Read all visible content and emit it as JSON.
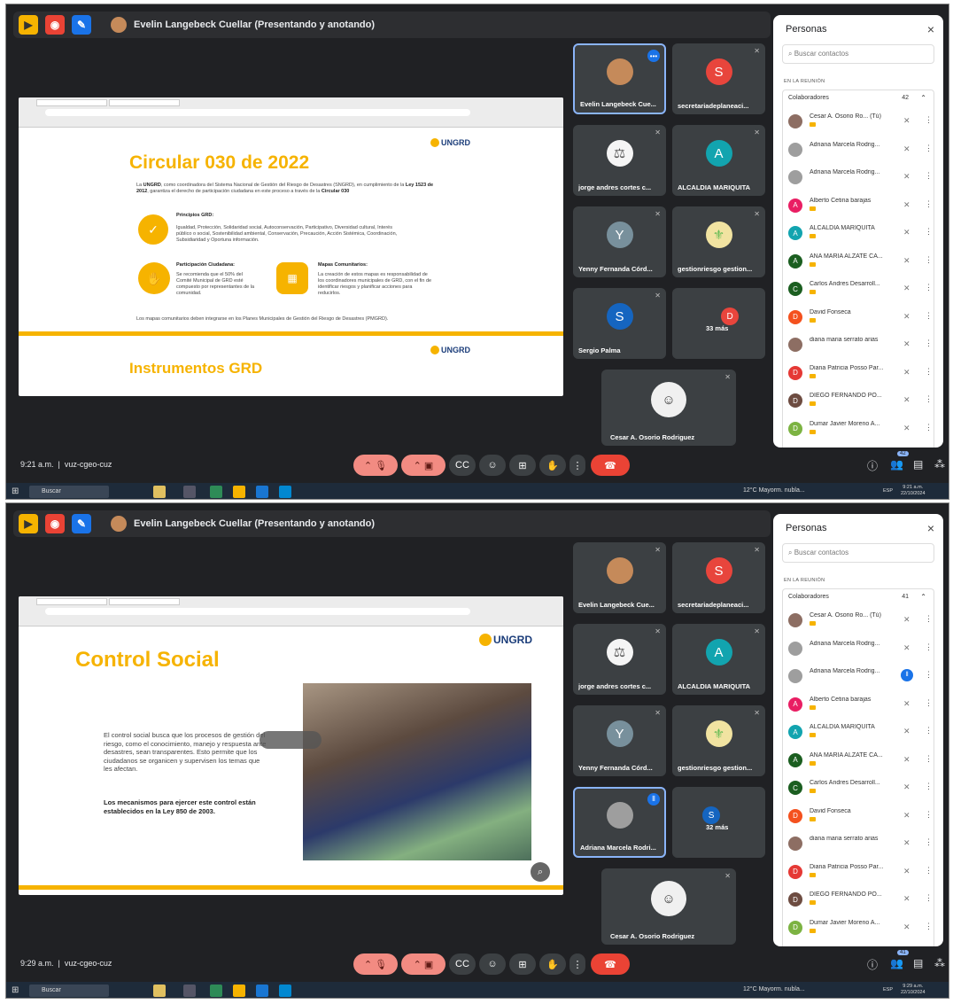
{
  "presenter_title": "Evelin Langebeck Cuellar (Presentando y anotando)",
  "screenshots": [
    {
      "slide": {
        "heading": "Circular 030 de 2022",
        "intro_prefix": "La ",
        "intro_bold1": "UNGRD",
        "intro_mid": ", como coordinadora del Sistema Nacional de Gestión del Riesgo de Desastres (SNGRD), en cumplimiento de la ",
        "intro_bold2": "Ley 1523 de 2012",
        "intro_mid2": ", garantiza el derecho de participación ciudadana en este proceso a través de la ",
        "intro_bold3": "Circular 030",
        "principios_title": "Principios GRD:",
        "principios_text": "Igualdad, Protección, Solidaridad social, Autoconservación, Participativo, Diversidad cultural, Interés público o social, Sostenibilidad ambiental, Conservación, Precaución, Acción Sistémica, Coordinación, Subsidiaridad y Oportuna información.",
        "participacion_title": "Participación Ciudadana:",
        "participacion_text": "Se recomienda que el 50% del Comité Municipal de GRD esté compuesto por representantes de la comunidad.",
        "mapas_title": "Mapas Comunitarios:",
        "mapas_text": "La creación de estos mapas es responsabilidad de los coordinadores municipales de GRD, con el fin de identificar riesgos y planificar acciones para reducirlos.",
        "footer_text": "Los mapas comunitarios deben integrarse en los Planes Municipales de Gestión del Riesgo de Desastres (PMGRD).",
        "heading2": "Instrumentos GRD",
        "logo": "UNGRD"
      },
      "tiles": [
        {
          "name": "Evelin Langebeck Cue...",
          "type": "photo"
        },
        {
          "name": "secretariadeplaneaci...",
          "letter": "S",
          "color": "#e8453c"
        },
        {
          "name": "jorge andres cortes c...",
          "type": "photo"
        },
        {
          "name": "ALCALDIA MARIQUITA",
          "letter": "A",
          "color": "#12a4af"
        },
        {
          "name": "Yenny Fernanda Córd...",
          "letter": "Y",
          "color": "#78909c"
        },
        {
          "name": "gestionriesgo gestion...",
          "type": "crest"
        },
        {
          "name": "Sergio Palma",
          "letter": "S",
          "color": "#1565c0"
        },
        {
          "name": "33 más",
          "letter": "D",
          "color": "#e8453c"
        },
        {
          "name": "Cesar A. Osorio Rodriguez",
          "type": "photo"
        }
      ],
      "time": "9:21 a.m.",
      "meeting_code": "vuz-cgeo-cuz",
      "people_count": "42",
      "clock_time": "9:21 a.m.",
      "clock_date": "22/10/2024"
    },
    {
      "slide": {
        "heading": "Control Social",
        "body": "El control social busca que los procesos de gestión del riesgo, como el conocimiento, manejo y respuesta ante desastres, sean transparentes. Esto permite que los ciudadanos se organicen y supervisen los temas que les afectan.",
        "bold": "Los mecanismos para ejercer este control están establecidos en la Ley 850 de 2003.",
        "logo": "UNGRD"
      },
      "tiles": [
        {
          "name": "Evelin Langebeck Cue...",
          "type": "photo"
        },
        {
          "name": "secretariadeplaneaci...",
          "letter": "S",
          "color": "#e8453c"
        },
        {
          "name": "jorge andres cortes c...",
          "type": "photo"
        },
        {
          "name": "ALCALDIA MARIQUITA",
          "letter": "A",
          "color": "#12a4af"
        },
        {
          "name": "Yenny Fernanda Córd...",
          "letter": "Y",
          "color": "#78909c"
        },
        {
          "name": "gestionriesgo gestion...",
          "type": "crest"
        },
        {
          "name": "Adriana Marcela Rodri...",
          "type": "photo"
        },
        {
          "name": "32 más",
          "letter": "S",
          "color": "#1565c0"
        },
        {
          "name": "Cesar A. Osorio Rodriguez",
          "type": "photo"
        }
      ],
      "time": "9:29 a.m.",
      "meeting_code": "vuz-cgeo-cuz",
      "people_count": "41",
      "clock_time": "9:29 a.m.",
      "clock_date": "22/10/2024"
    }
  ],
  "panel": {
    "title": "Personas",
    "search_placeholder": "Buscar contactos",
    "section": "EN LA REUNIÓN",
    "group": "Colaboradores",
    "counts": [
      "42",
      "41"
    ],
    "people": [
      {
        "name": "Cesar A. Osorio Ro... (Tú)",
        "letter": "",
        "color": "#8d6e63"
      },
      {
        "name": "Adriana Marcela Rodrig...",
        "letter": "",
        "color": "#9e9e9e"
      },
      {
        "name": "Adriana Marcela Rodrig...",
        "letter": "",
        "color": "#9e9e9e"
      },
      {
        "name": "Alberto Cetina barajas",
        "letter": "A",
        "color": "#e91e63"
      },
      {
        "name": "ALCALDIA MARIQUITA",
        "letter": "A",
        "color": "#12a4af"
      },
      {
        "name": "ANA MARIA ALZATE CA...",
        "letter": "A",
        "color": "#1b5e20"
      },
      {
        "name": "Carlos Andres Desarroll...",
        "letter": "C",
        "color": "#1b5e20"
      },
      {
        "name": "David Fonseca",
        "letter": "D",
        "color": "#f4511e"
      },
      {
        "name": "diana maria serrato arias",
        "letter": "",
        "color": "#8d6e63"
      },
      {
        "name": "Diana Patricia Posso Par...",
        "letter": "D",
        "color": "#e53935"
      },
      {
        "name": "DIEGO FERNANDO PO...",
        "letter": "D",
        "color": "#6d4c41"
      },
      {
        "name": "Dumar Javier Moreno A...",
        "letter": "D",
        "color": "#7cb342"
      }
    ]
  },
  "taskbar": {
    "search": "Buscar",
    "weather": "12°C  Mayorm. nubla...",
    "lang": "ESP"
  },
  "icons": {
    "close": "×",
    "search": "⌕",
    "mic_off": "🎙",
    "more": "⋮",
    "chevron_up": "⌃"
  }
}
